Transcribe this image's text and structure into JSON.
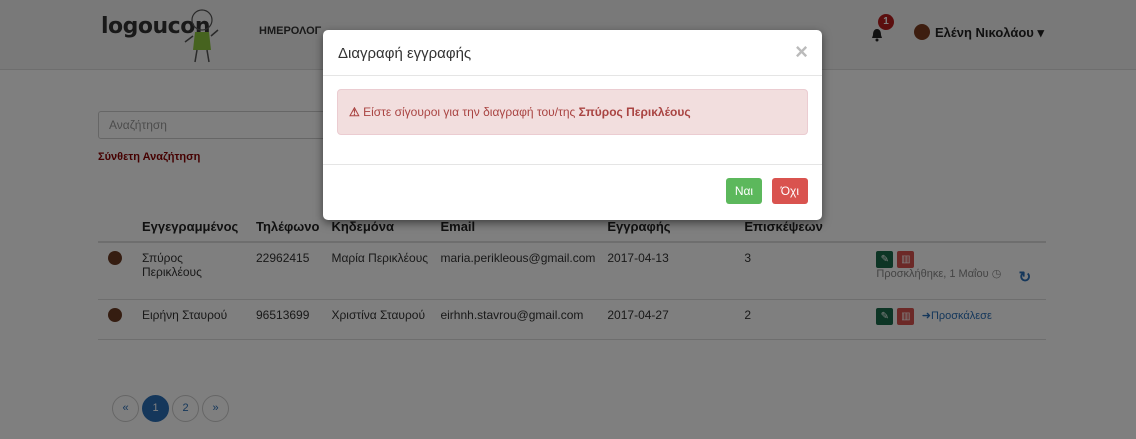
{
  "nav": {
    "logo": "logoucon",
    "menu_item": "ΗΜΕΡΟΛΟΓ",
    "notification_count": "1",
    "user_name": "Ελένη Νικολάου"
  },
  "search": {
    "placeholder": "Αναζήτηση",
    "advanced_label": "Σύνθετη Αναζήτηση"
  },
  "table": {
    "headers": [
      "Εγγεγραμμένος",
      "Τηλέφωνο",
      "Κηδεμόνα",
      "Email",
      "Εγγραφής",
      "Επισκέψεων"
    ],
    "rows": [
      {
        "name": "Σπύρος Περικλέους",
        "phone": "22962415",
        "guardian": "Μαρία Περικλέους",
        "email": "maria.perikleous@gmail.com",
        "registered": "2017-04-13",
        "visits": "3",
        "status": "Προσκλήθηκε, 1 Μαΐου"
      },
      {
        "name": "Ειρήνη Σταυρού",
        "phone": "96513699",
        "guardian": "Χριστίνα Σταυρού",
        "email": "eirhnh.stavrou@gmail.com",
        "registered": "2017-04-27",
        "visits": "2",
        "status": "Προσκάλεσε"
      }
    ]
  },
  "pagination": {
    "prev": "«",
    "pages": [
      "1",
      "2"
    ],
    "next": "»",
    "active_page": "1"
  },
  "modal": {
    "title": "Διαγραφή εγγραφής",
    "close": "×",
    "message_prefix": "Είστε σίγουροι για την διαγραφή του/της ",
    "message_name": "Σπύρος Περικλέους",
    "yes_label": "Ναι",
    "no_label": "Όχι"
  },
  "colors": {
    "alert_bg": "#f2dede",
    "alert_text": "#a94442",
    "yes_button": "#5cb85c",
    "no_button": "#d9534f",
    "link": "#2a6fb7"
  },
  "icons": {
    "warning": "warning-icon",
    "bell": "bell-icon",
    "edit": "pencil-icon",
    "delete": "trash-icon",
    "invite": "arrow-right-icon",
    "refresh": "refresh-icon",
    "clock": "clock-icon"
  }
}
